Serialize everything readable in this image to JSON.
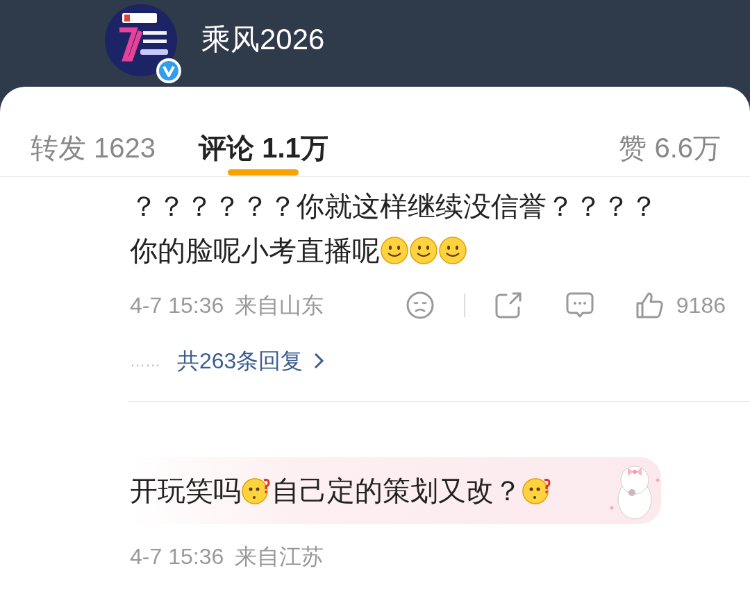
{
  "header": {
    "name": "乘风2026",
    "verified": true
  },
  "tabs": [
    {
      "label": "转发 1623",
      "selected": false
    },
    {
      "label": "评论 1.1万",
      "selected": true
    },
    {
      "label": "赞 6.6万",
      "selected": false
    }
  ],
  "comments": [
    {
      "kind": "plain",
      "lines": [
        [
          {
            "kind": "text",
            "text": "？？？？？？你就这样继续没信誉？？？？"
          }
        ],
        [
          {
            "kind": "text",
            "text": "你的脸呢小考直播呢"
          },
          {
            "kind": "smile"
          },
          {
            "kind": "smile"
          },
          {
            "kind": "smile"
          }
        ]
      ],
      "time": "4-7 15:36",
      "location": "来自山东",
      "likes": "9186",
      "reply_dots": "……",
      "replies": "共263条回复"
    },
    {
      "kind": "bubble",
      "lines": [
        [
          {
            "kind": "text",
            "text": "开玩笑吗"
          },
          {
            "kind": "puzzled"
          },
          {
            "kind": "text",
            "text": "自己定的策划又改？"
          },
          {
            "kind": "puzzled"
          }
        ]
      ],
      "time": "4-7 15:36",
      "location": "来自江苏"
    }
  ]
}
